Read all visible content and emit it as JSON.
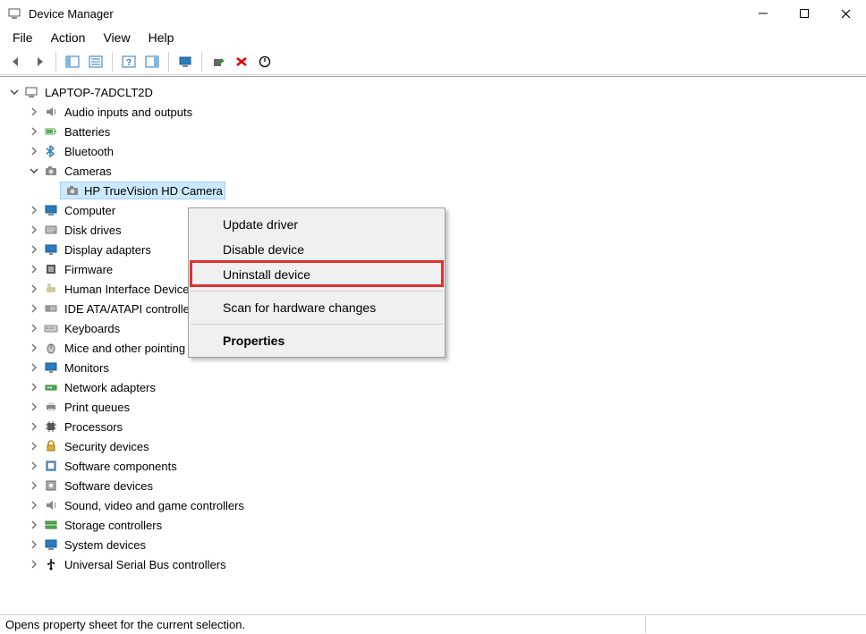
{
  "window": {
    "title": "Device Manager"
  },
  "menubar": {
    "file": "File",
    "action": "Action",
    "view": "View",
    "help": "Help"
  },
  "tree": {
    "root": "LAPTOP-7ADCLT2D",
    "nodes": [
      {
        "label": "Audio inputs and outputs",
        "icon": "speaker-icon",
        "expanded": false
      },
      {
        "label": "Batteries",
        "icon": "battery-icon",
        "expanded": false
      },
      {
        "label": "Bluetooth",
        "icon": "bluetooth-icon",
        "expanded": false
      },
      {
        "label": "Cameras",
        "icon": "camera-icon",
        "expanded": true,
        "children": [
          {
            "label": "HP TrueVision HD Camera",
            "icon": "camera-icon"
          }
        ]
      },
      {
        "label": "Computer",
        "icon": "computer-icon",
        "expanded": false
      },
      {
        "label": "Disk drives",
        "icon": "disk-icon",
        "expanded": false
      },
      {
        "label": "Display adapters",
        "icon": "display-icon",
        "expanded": false
      },
      {
        "label": "Firmware",
        "icon": "firmware-icon",
        "expanded": false
      },
      {
        "label": "Human Interface Devices",
        "icon": "hid-icon",
        "expanded": false
      },
      {
        "label": "IDE ATA/ATAPI controllers",
        "icon": "ide-icon",
        "expanded": false
      },
      {
        "label": "Keyboards",
        "icon": "keyboard-icon",
        "expanded": false
      },
      {
        "label": "Mice and other pointing devices",
        "icon": "mouse-icon",
        "expanded": false
      },
      {
        "label": "Monitors",
        "icon": "monitor-icon",
        "expanded": false
      },
      {
        "label": "Network adapters",
        "icon": "network-icon",
        "expanded": false
      },
      {
        "label": "Print queues",
        "icon": "printer-icon",
        "expanded": false
      },
      {
        "label": "Processors",
        "icon": "processor-icon",
        "expanded": false
      },
      {
        "label": "Security devices",
        "icon": "security-icon",
        "expanded": false
      },
      {
        "label": "Software components",
        "icon": "software-icon",
        "expanded": false
      },
      {
        "label": "Software devices",
        "icon": "software-dev-icon",
        "expanded": false
      },
      {
        "label": "Sound, video and game controllers",
        "icon": "sound-icon",
        "expanded": false
      },
      {
        "label": "Storage controllers",
        "icon": "storage-icon",
        "expanded": false
      },
      {
        "label": "System devices",
        "icon": "system-icon",
        "expanded": false
      },
      {
        "label": "Universal Serial Bus controllers",
        "icon": "usb-icon",
        "expanded": false
      }
    ]
  },
  "context_menu": {
    "update_driver": "Update driver",
    "disable_device": "Disable device",
    "uninstall_device": "Uninstall device",
    "scan_hardware": "Scan for hardware changes",
    "properties": "Properties"
  },
  "statusbar": {
    "text": "Opens property sheet for the current selection."
  }
}
